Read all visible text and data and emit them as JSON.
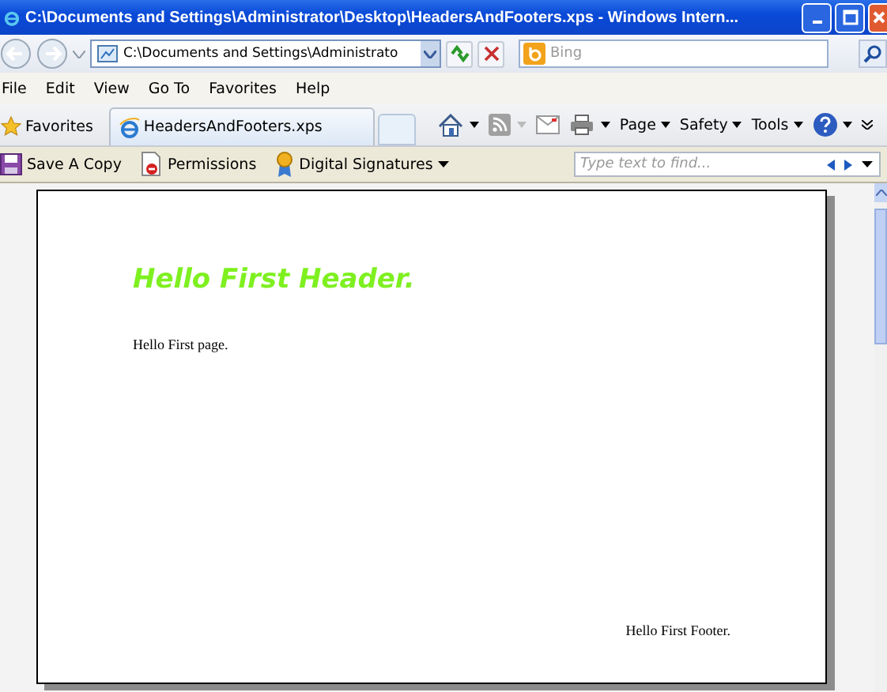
{
  "window": {
    "title": "C:\\Documents and Settings\\Administrator\\Desktop\\HeadersAndFooters.xps - Windows Intern..."
  },
  "address_bar": {
    "value": "C:\\Documents and Settings\\Administrato"
  },
  "search": {
    "placeholder": "Bing"
  },
  "menu": [
    "File",
    "Edit",
    "View",
    "Go To",
    "Favorites",
    "Help"
  ],
  "favorites_button": {
    "label": "Favorites"
  },
  "tabs": [
    {
      "label": "HeadersAndFooters.xps",
      "selected": true
    }
  ],
  "command_bar": [
    "Page",
    "Safety",
    "Tools"
  ],
  "xps_toolbar": {
    "items": [
      {
        "kind": "save",
        "label": "Save A Copy"
      },
      {
        "kind": "permissions",
        "label": "Permissions"
      },
      {
        "kind": "signatures",
        "label": "Digital Signatures"
      }
    ],
    "find": {
      "placeholder": "Type text to find..."
    }
  },
  "document": {
    "header": "Hello First Header.",
    "body": "Hello First page.",
    "footer": "Hello First Footer."
  }
}
